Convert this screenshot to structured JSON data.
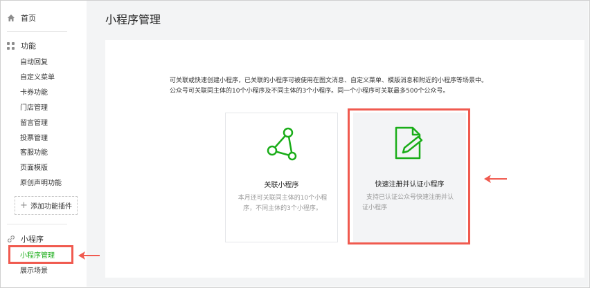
{
  "sidebar": {
    "home_label": "首页",
    "function_section": {
      "label": "功能",
      "items": [
        {
          "label": "自动回复"
        },
        {
          "label": "自定义菜单"
        },
        {
          "label": "卡券功能"
        },
        {
          "label": "门店管理"
        },
        {
          "label": "留言管理"
        },
        {
          "label": "投票管理"
        },
        {
          "label": "客服功能"
        },
        {
          "label": "页面模版"
        },
        {
          "label": "原创声明功能"
        }
      ],
      "add_plugin_label": "添加功能插件"
    },
    "miniprogram_section": {
      "label": "小程序",
      "items": [
        {
          "label": "小程序管理",
          "active": true
        },
        {
          "label": "展示场景"
        }
      ]
    }
  },
  "main": {
    "title": "小程序管理",
    "description_line1": "可关联或快速创建小程序，已关联的小程序可被使用在图文消息、自定义菜单、模版消息和附近的小程序等场景中。",
    "description_line2": "公众号可关联同主体的10个小程序及不同主体的3个小程序。同一个小程序可关联最多500个公众号。",
    "cards": [
      {
        "title": "关联小程序",
        "desc_line1": "本月还可关联同主体的10个小程",
        "desc_line2": "序，不同主体的3个小程序。",
        "icon": "network-graph-icon"
      },
      {
        "title": "快速注册并认证小程序",
        "desc_line1": "支持已认证公众号快速注册并认",
        "desc_line2": "证小程序",
        "icon": "document-edit-icon"
      }
    ]
  },
  "colors": {
    "accent_green": "#1aad19",
    "annotation_red": "#f05a4f",
    "background_gray": "#f3f4f5"
  }
}
